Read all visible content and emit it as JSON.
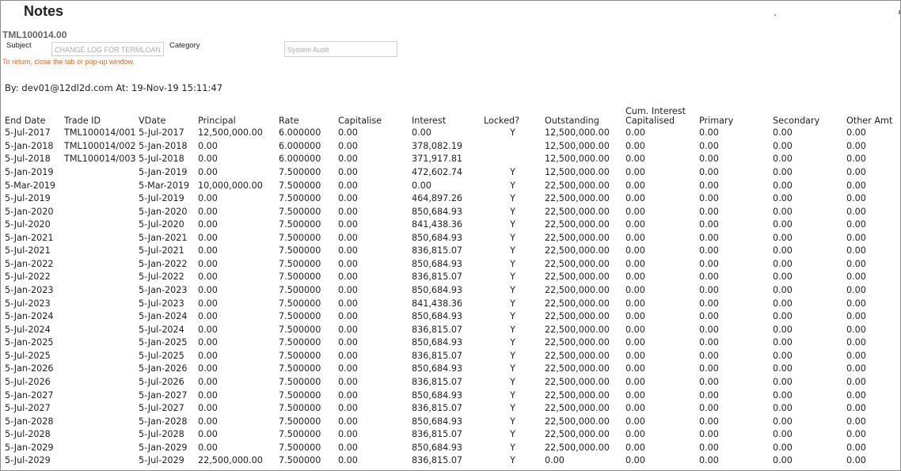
{
  "page": {
    "title": "Notes",
    "reference": "TML100014.00",
    "subject_label": "Subject",
    "subject_value": "CHANGE LOG FOR TERMLOAN",
    "category_label": "Category",
    "category_value": "System Audit",
    "return_hint": "To return, close the tab or pop-up window.",
    "author_line": "By: dev01@12dl2d.com At: 19-Nov-19 15:11:47"
  },
  "table": {
    "columns": [
      "End Date",
      "Trade ID",
      "VDate",
      "Principal",
      "Rate",
      "Capitalise",
      "Interest",
      "Locked?",
      "Outstanding",
      "Cum. Interest Capitalised",
      "Primary",
      "Secondary",
      "Other Amt"
    ],
    "rows": [
      [
        "5-Jul-2017",
        "TML100014/001",
        "5-Jul-2017",
        "12,500,000.00",
        "6.000000",
        "0.00",
        "0.00",
        "Y",
        "12,500,000.00",
        "0.00",
        "0.00",
        "0.00",
        "0.00"
      ],
      [
        "5-Jan-2018",
        "TML100014/002",
        "5-Jan-2018",
        "0.00",
        "6.000000",
        "0.00",
        "378,082.19",
        "",
        "12,500,000.00",
        "0.00",
        "0.00",
        "0.00",
        "0.00"
      ],
      [
        "5-Jul-2018",
        "TML100014/003",
        "5-Jul-2018",
        "0.00",
        "6.000000",
        "0.00",
        "371,917.81",
        "",
        "12,500,000.00",
        "0.00",
        "0.00",
        "0.00",
        "0.00"
      ],
      [
        "5-Jan-2019",
        "",
        "5-Jan-2019",
        "0.00",
        "7.500000",
        "0.00",
        "472,602.74",
        "Y",
        "12,500,000.00",
        "0.00",
        "0.00",
        "0.00",
        "0.00"
      ],
      [
        "5-Mar-2019",
        "",
        "5-Mar-2019",
        "10,000,000.00",
        "7.500000",
        "0.00",
        "0.00",
        "Y",
        "22,500,000.00",
        "0.00",
        "0.00",
        "0.00",
        "0.00"
      ],
      [
        "5-Jul-2019",
        "",
        "5-Jul-2019",
        "0.00",
        "7.500000",
        "0.00",
        "464,897.26",
        "Y",
        "22,500,000.00",
        "0.00",
        "0.00",
        "0.00",
        "0.00"
      ],
      [
        "5-Jan-2020",
        "",
        "5-Jan-2020",
        "0.00",
        "7.500000",
        "0.00",
        "850,684.93",
        "Y",
        "22,500,000.00",
        "0.00",
        "0.00",
        "0.00",
        "0.00"
      ],
      [
        "5-Jul-2020",
        "",
        "5-Jul-2020",
        "0.00",
        "7.500000",
        "0.00",
        "841,438.36",
        "Y",
        "22,500,000.00",
        "0.00",
        "0.00",
        "0.00",
        "0.00"
      ],
      [
        "5-Jan-2021",
        "",
        "5-Jan-2021",
        "0.00",
        "7.500000",
        "0.00",
        "850,684.93",
        "Y",
        "22,500,000.00",
        "0.00",
        "0.00",
        "0.00",
        "0.00"
      ],
      [
        "5-Jul-2021",
        "",
        "5-Jul-2021",
        "0.00",
        "7.500000",
        "0.00",
        "836,815.07",
        "Y",
        "22,500,000.00",
        "0.00",
        "0.00",
        "0.00",
        "0.00"
      ],
      [
        "5-Jan-2022",
        "",
        "5-Jan-2022",
        "0.00",
        "7.500000",
        "0.00",
        "850,684.93",
        "Y",
        "22,500,000.00",
        "0.00",
        "0.00",
        "0.00",
        "0.00"
      ],
      [
        "5-Jul-2022",
        "",
        "5-Jul-2022",
        "0.00",
        "7.500000",
        "0.00",
        "836,815.07",
        "Y",
        "22,500,000.00",
        "0.00",
        "0.00",
        "0.00",
        "0.00"
      ],
      [
        "5-Jan-2023",
        "",
        "5-Jan-2023",
        "0.00",
        "7.500000",
        "0.00",
        "850,684.93",
        "Y",
        "22,500,000.00",
        "0.00",
        "0.00",
        "0.00",
        "0.00"
      ],
      [
        "5-Jul-2023",
        "",
        "5-Jul-2023",
        "0.00",
        "7.500000",
        "0.00",
        "841,438.36",
        "Y",
        "22,500,000.00",
        "0.00",
        "0.00",
        "0.00",
        "0.00"
      ],
      [
        "5-Jan-2024",
        "",
        "5-Jan-2024",
        "0.00",
        "7.500000",
        "0.00",
        "850,684.93",
        "Y",
        "22,500,000.00",
        "0.00",
        "0.00",
        "0.00",
        "0.00"
      ],
      [
        "5-Jul-2024",
        "",
        "5-Jul-2024",
        "0.00",
        "7.500000",
        "0.00",
        "836,815.07",
        "Y",
        "22,500,000.00",
        "0.00",
        "0.00",
        "0.00",
        "0.00"
      ],
      [
        "5-Jan-2025",
        "",
        "5-Jan-2025",
        "0.00",
        "7.500000",
        "0.00",
        "850,684.93",
        "Y",
        "22,500,000.00",
        "0.00",
        "0.00",
        "0.00",
        "0.00"
      ],
      [
        "5-Jul-2025",
        "",
        "5-Jul-2025",
        "0.00",
        "7.500000",
        "0.00",
        "836,815.07",
        "Y",
        "22,500,000.00",
        "0.00",
        "0.00",
        "0.00",
        "0.00"
      ],
      [
        "5-Jan-2026",
        "",
        "5-Jan-2026",
        "0.00",
        "7.500000",
        "0.00",
        "850,684.93",
        "Y",
        "22,500,000.00",
        "0.00",
        "0.00",
        "0.00",
        "0.00"
      ],
      [
        "5-Jul-2026",
        "",
        "5-Jul-2026",
        "0.00",
        "7.500000",
        "0.00",
        "836,815.07",
        "Y",
        "22,500,000.00",
        "0.00",
        "0.00",
        "0.00",
        "0.00"
      ],
      [
        "5-Jan-2027",
        "",
        "5-Jan-2027",
        "0.00",
        "7.500000",
        "0.00",
        "850,684.93",
        "Y",
        "22,500,000.00",
        "0.00",
        "0.00",
        "0.00",
        "0.00"
      ],
      [
        "5-Jul-2027",
        "",
        "5-Jul-2027",
        "0.00",
        "7.500000",
        "0.00",
        "836,815.07",
        "Y",
        "22,500,000.00",
        "0.00",
        "0.00",
        "0.00",
        "0.00"
      ],
      [
        "5-Jan-2028",
        "",
        "5-Jan-2028",
        "0.00",
        "7.500000",
        "0.00",
        "850,684.93",
        "Y",
        "22,500,000.00",
        "0.00",
        "0.00",
        "0.00",
        "0.00"
      ],
      [
        "5-Jul-2028",
        "",
        "5-Jul-2028",
        "0.00",
        "7.500000",
        "0.00",
        "836,815.07",
        "Y",
        "22,500,000.00",
        "0.00",
        "0.00",
        "0.00",
        "0.00"
      ],
      [
        "5-Jan-2029",
        "",
        "5-Jan-2029",
        "0.00",
        "7.500000",
        "0.00",
        "850,684.93",
        "Y",
        "22,500,000.00",
        "0.00",
        "0.00",
        "0.00",
        "0.00"
      ],
      [
        "5-Jul-2029",
        "",
        "5-Jul-2029",
        "22,500,000.00",
        "7.500000",
        "0.00",
        "836,815.07",
        "Y",
        "0.00",
        "0.00",
        "0.00",
        "0.00",
        "0.00"
      ]
    ]
  }
}
